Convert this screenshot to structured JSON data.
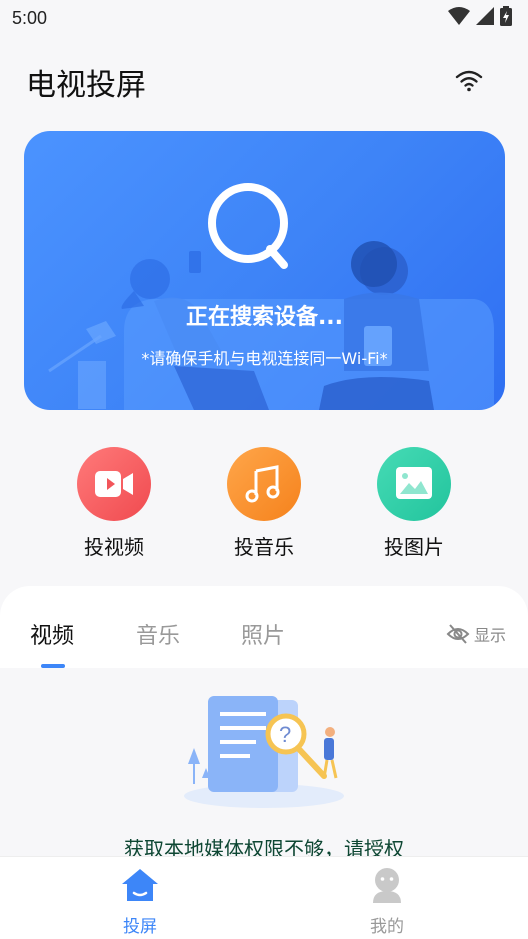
{
  "status": {
    "time": "5:00",
    "icons": [
      "wifi-icon",
      "signal-icon",
      "battery-icon"
    ]
  },
  "header": {
    "title": "电视投屏",
    "wifi_icon": "wifi-icon"
  },
  "banner": {
    "title": "正在搜索设备...",
    "subtitle": "*请确保手机与电视连接同一Wi-Fi*"
  },
  "actions": [
    {
      "label": "投视频",
      "icon": "video-icon",
      "color": "#fb5b5f"
    },
    {
      "label": "投音乐",
      "icon": "music-icon",
      "color": "#f98b2c"
    },
    {
      "label": "投图片",
      "icon": "image-icon",
      "color": "#2bc9a3"
    }
  ],
  "tabs": [
    {
      "label": "视频",
      "active": true
    },
    {
      "label": "音乐",
      "active": false
    },
    {
      "label": "照片",
      "active": false
    }
  ],
  "show_toggle": {
    "label": "显示",
    "icon": "eye-off-icon"
  },
  "empty_state": {
    "message": "获取本地媒体权限不够，请授权"
  },
  "bottom_nav": [
    {
      "label": "投屏",
      "icon": "home-icon",
      "active": true
    },
    {
      "label": "我的",
      "icon": "profile-icon",
      "active": false
    }
  ],
  "colors": {
    "accent": "#3d86f8",
    "banner": "#3e84f7",
    "inactive": "#999999"
  }
}
